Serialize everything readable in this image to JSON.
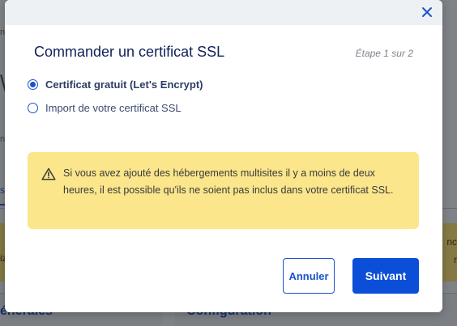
{
  "background": {
    "frag_a": "n",
    "frag_b": "\\",
    "frag_c": "na",
    "tab_label": "s",
    "frag_d": "iz",
    "frag_e": "nc",
    "frag_f": "r",
    "section_left": "énérales",
    "section_right": "Configuration"
  },
  "modal": {
    "title": "Commander un certificat SSL",
    "step": "Étape 1 sur 2",
    "options": [
      {
        "label": "Certificat gratuit (Let's Encrypt)",
        "selected": true
      },
      {
        "label": "Import de votre certificat SSL",
        "selected": false
      }
    ],
    "warning": {
      "icon": "warning-triangle-icon",
      "text": "Si vous avez ajouté des hébergements multisites il y a moins de deux heures, il est possible qu'ils ne soient pas inclus dans votre certificat SSL."
    },
    "buttons": {
      "cancel": "Annuler",
      "next": "Suivant"
    },
    "close_icon": "close-icon"
  },
  "colors": {
    "accent": "#0b4fd9",
    "title": "#0f2058",
    "warning_bg": "#fbe68c",
    "overlay": "#7f8287"
  }
}
